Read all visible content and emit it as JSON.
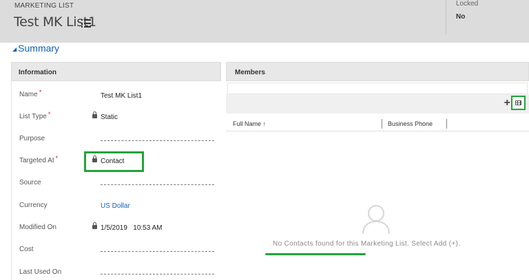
{
  "header": {
    "entity_type": "MARKETING LIST",
    "record_name": "Test MK List1",
    "locked_label": "Locked",
    "locked_value": "No"
  },
  "summary": {
    "label": "Summary"
  },
  "information": {
    "title": "Information",
    "fields": [
      {
        "label": "Name",
        "required": true,
        "value": "Test MK List1",
        "locked": false
      },
      {
        "label": "List Type",
        "required": true,
        "value": "Static",
        "locked": true
      },
      {
        "label": "Purpose",
        "required": false,
        "value": "",
        "locked": false
      },
      {
        "label": "Targeted At",
        "required": true,
        "value": "Contact",
        "locked": true
      },
      {
        "label": "Source",
        "required": false,
        "value": "",
        "locked": false
      },
      {
        "label": "Currency",
        "required": false,
        "value": "US Dollar",
        "locked": false
      },
      {
        "label": "Modified On",
        "required": false,
        "value": "1/5/2019   10:53 AM",
        "locked": true
      },
      {
        "label": "Cost",
        "required": false,
        "value": "",
        "locked": false
      },
      {
        "label": "Last Used On",
        "required": false,
        "value": "",
        "locked": false
      }
    ],
    "required_marker": "*"
  },
  "members": {
    "title": "Members",
    "add_icon": "+",
    "columns": [
      {
        "label": "Full Name",
        "sort": "↑"
      },
      {
        "label": "Business Phone",
        "sort": ""
      }
    ],
    "empty_message": "No Contacts found for this Marketing List. Select Add (+)."
  },
  "colors": {
    "accent_link": "#1160b7",
    "highlight_green": "#22a33a",
    "required_red": "#d11b1b"
  }
}
